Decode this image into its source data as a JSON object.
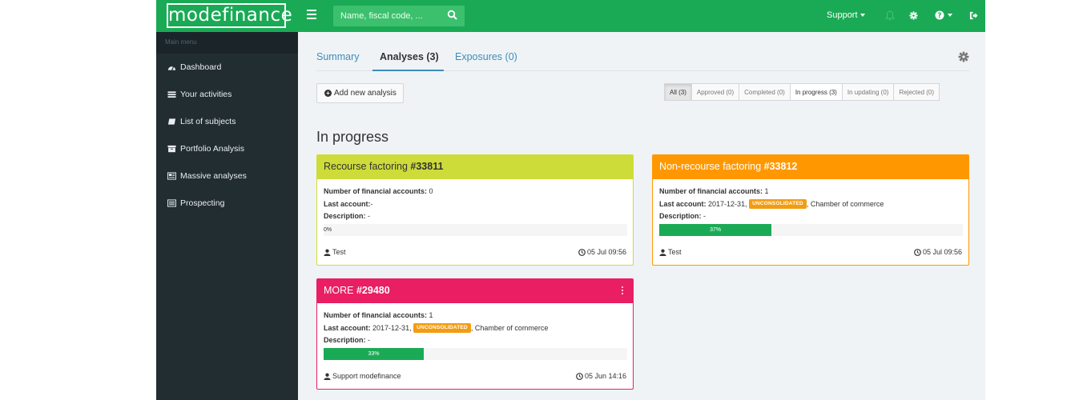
{
  "brand": {
    "logo_text": "modefinance"
  },
  "search": {
    "placeholder": "Name, fiscal code, ..."
  },
  "topnav": {
    "support_label": "Support"
  },
  "sidebar": {
    "header": "Main menu",
    "items": [
      {
        "label": "Dashboard",
        "icon": "dashboard-icon"
      },
      {
        "label": "Your activities",
        "icon": "activities-icon"
      },
      {
        "label": "List of subjects",
        "icon": "book-icon"
      },
      {
        "label": "Portfolio Analysis",
        "icon": "archive-icon"
      },
      {
        "label": "Massive analyses",
        "icon": "massive-icon"
      },
      {
        "label": "Prospecting",
        "icon": "list-icon"
      }
    ]
  },
  "tabs": [
    {
      "label": "Summary"
    },
    {
      "label": "Analyses (3)"
    },
    {
      "label": "Exposures (0)"
    }
  ],
  "toolbar": {
    "add_label": "Add new analysis"
  },
  "filters": [
    {
      "label": "All (3)"
    },
    {
      "label": "Approved (0)"
    },
    {
      "label": "Completed (0)"
    },
    {
      "label": "In progress (3)"
    },
    {
      "label": "In updating (0)"
    },
    {
      "label": "Rejected (0)"
    }
  ],
  "section": {
    "title": "In progress"
  },
  "labels": {
    "num_accounts": "Number of financial accounts:",
    "last_account": "Last account:",
    "description": "Description:"
  },
  "cards": [
    {
      "type": "Recourse factoring",
      "id": "#33811",
      "num_accounts": "0",
      "last_account_date": "-",
      "badge": "",
      "last_account_source": "",
      "description": "-",
      "progress": 0,
      "progress_text": "0%",
      "user": "Test",
      "date": "05 Jul 09:56",
      "color": "#cddc39"
    },
    {
      "type": "Non-recourse factoring",
      "id": "#33812",
      "num_accounts": "1",
      "last_account_date": "2017-12-31,",
      "badge": "UNCONSOLIDATED",
      "last_account_source": ", Chamber of commerce",
      "description": "-",
      "progress": 37,
      "progress_text": "37%",
      "user": "Test",
      "date": "05 Jul 09:56",
      "color": "#ff9800"
    },
    {
      "type": "MORE",
      "id": "#29480",
      "num_accounts": "1",
      "last_account_date": "2017-12-31,",
      "badge": "UNCONSOLIDATED",
      "last_account_source": ", Chamber of commerce",
      "description": "-",
      "progress": 33,
      "progress_text": "33%",
      "user": "Support modefinance",
      "date": "05 Jun 14:16",
      "color": "#e91e63"
    }
  ],
  "colors": {
    "brand_green": "#1aaa55",
    "sidebar_bg": "#222d32",
    "link_blue": "#3c8dbc",
    "badge_orange": "#f39c12"
  }
}
